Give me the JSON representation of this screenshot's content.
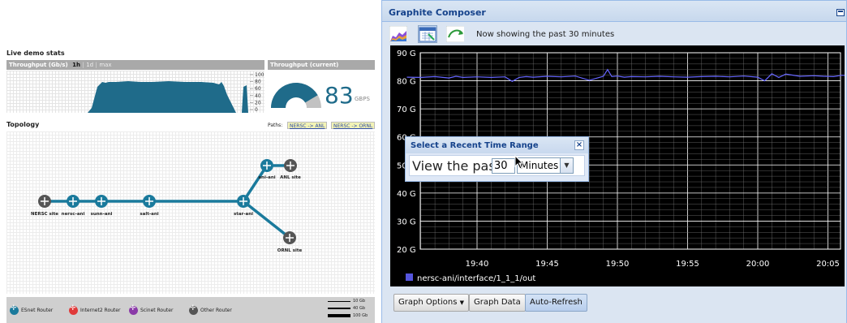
{
  "live_stats": {
    "title": "Live demo stats",
    "throughput_header": "Throughput (Gb/s)",
    "range_options": [
      "1h",
      "1d",
      "max"
    ],
    "range_selected": "1h",
    "y_ticks": [
      "100",
      "80",
      "60",
      "40",
      "20",
      "0"
    ],
    "current_header": "Throughput (current)",
    "current_value": "83",
    "current_unit": "GBPS",
    "gauge_fraction": 0.83
  },
  "topology": {
    "title": "Topology",
    "paths_label": "Paths:",
    "paths": [
      "NERSC -> ANL",
      "NERSC -> ORNL"
    ],
    "nodes": [
      {
        "label": "NERSC site",
        "color": "#555555"
      },
      {
        "label": "nersc-ani",
        "color": "#1a7a9c"
      },
      {
        "label": "sunn-ani",
        "color": "#1a7a9c"
      },
      {
        "label": "salt-ani",
        "color": "#1a7a9c"
      },
      {
        "label": "star-ani",
        "color": "#1a7a9c"
      },
      {
        "label": "ani-ani",
        "color": "#1a7a9c"
      },
      {
        "label": "ANL site",
        "color": "#555555"
      },
      {
        "label": "ORNL site",
        "color": "#555555"
      }
    ],
    "legend": [
      {
        "label": "ESnet Router",
        "color": "#1a7a9c"
      },
      {
        "label": "Internet2 Router",
        "color": "#e03a3a"
      },
      {
        "label": "Scinet Router",
        "color": "#8a3aa8"
      },
      {
        "label": "Other Router",
        "color": "#555555"
      }
    ],
    "capacities": [
      "10 Gb",
      "40 Gb",
      "100 Gb"
    ],
    "link_color": "#1a7a9c"
  },
  "composer": {
    "title": "Graphite Composer",
    "showing_text": "Now showing the past 30 minutes",
    "buttons": {
      "graph_options": "Graph Options",
      "graph_data": "Graph Data",
      "auto_refresh": "Auto-Refresh"
    },
    "dialog": {
      "title": "Select a Recent Time Range",
      "label": "View the past",
      "value": "30",
      "unit": "Minutes",
      "close": "×"
    },
    "series_color": "#6666ff",
    "legend_swatch_color": "#5555dd"
  },
  "chart_data": {
    "type": "line",
    "title": "",
    "xlabel": "",
    "ylabel": "",
    "y_ticks": [
      "20 G",
      "30 G",
      "40 G",
      "50 G",
      "60 G",
      "70 G",
      "80 G",
      "90 G"
    ],
    "x_ticks": [
      "19:40",
      "19:45",
      "19:50",
      "19:55",
      "20:00",
      "20:05"
    ],
    "ylim_gbps": [
      20,
      90
    ],
    "series": [
      {
        "name": "nersc-ani/interface/1_1_1/out",
        "x_minutes_after_1935": [
          0,
          1,
          2,
          3,
          3.5,
          4,
          5,
          6,
          7,
          7.5,
          8,
          8.5,
          9,
          10,
          11,
          12,
          13,
          14,
          14.3,
          14.6,
          15,
          15.5,
          16,
          17,
          18,
          19,
          20,
          21,
          22,
          23,
          24,
          25,
          25.5,
          26,
          26.5,
          27,
          28,
          29,
          29.7,
          30.4,
          31,
          32,
          32.5,
          33,
          33.5,
          34,
          35,
          35.8,
          36.3
        ],
        "y_gbps": [
          81.3,
          81.2,
          81.5,
          81.0,
          81.6,
          81.2,
          81.4,
          81.2,
          81.4,
          79.8,
          81.2,
          81.5,
          81.3,
          81.6,
          81.4,
          81.7,
          80.2,
          81.6,
          84.0,
          81.5,
          81.7,
          81.3,
          81.5,
          81.4,
          81.6,
          81.4,
          81.3,
          81.5,
          81.6,
          81.4,
          81.7,
          81.3,
          80.0,
          82.5,
          81.2,
          82.4,
          81.6,
          81.8,
          81.6,
          81.5,
          82.0,
          81.7,
          81.7,
          83.6,
          79.6,
          81.3,
          80.8,
          78.5,
          81.5
        ]
      }
    ]
  }
}
